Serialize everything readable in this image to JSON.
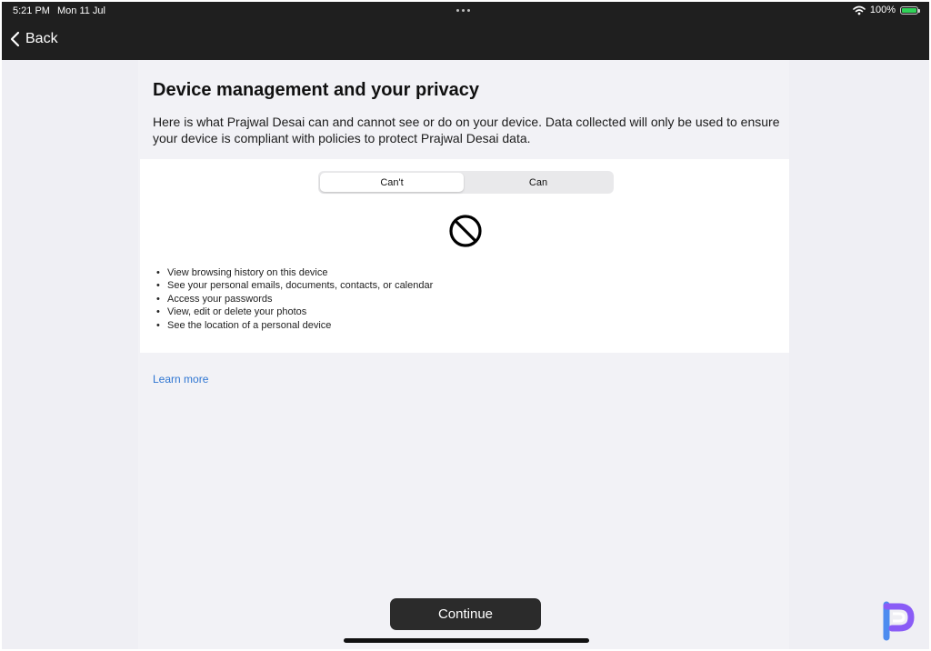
{
  "status_bar": {
    "time": "5:21 PM",
    "date": "Mon 11 Jul",
    "battery": "100%",
    "battery_level": 1.0,
    "icons": [
      "wifi-icon",
      "battery-icon"
    ]
  },
  "nav": {
    "back_label": "Back",
    "back_icon": "chevron-left-icon"
  },
  "page": {
    "title": "Device management and your privacy",
    "description": "Here is what Prajwal Desai can and cannot see or do on your device. Data collected will only be used to ensure your device is compliant with policies to protect Prajwal Desai data."
  },
  "segments": {
    "cant": "Can't",
    "can": "Can",
    "selected": "Can't"
  },
  "card": {
    "icon": "prohibited-icon",
    "items": [
      "View browsing history on this device",
      "See your personal emails, documents, contacts, or calendar",
      "Access your passwords",
      "View, edit or delete your photos",
      "See the location of a personal device"
    ]
  },
  "learn_more": "Learn more",
  "continue_label": "Continue",
  "colors": {
    "accent_link": "#2f76d2",
    "bar": "#1f1f1f",
    "background": "#f2f2f6",
    "battery": "#30d158",
    "button": "#2b2b2b"
  }
}
